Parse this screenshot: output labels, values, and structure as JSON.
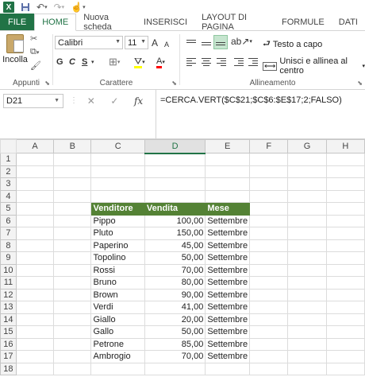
{
  "app": {
    "logo": "X"
  },
  "qat": {
    "icons": [
      "save-icon",
      "undo-icon",
      "redo-icon",
      "touch-icon"
    ]
  },
  "tabs": [
    {
      "label": "FILE"
    },
    {
      "label": "HOME"
    },
    {
      "label": "Nuova scheda"
    },
    {
      "label": "INSERISCI"
    },
    {
      "label": "LAYOUT DI PAGINA"
    },
    {
      "label": "FORMULE"
    },
    {
      "label": "DATI"
    }
  ],
  "ribbon": {
    "clipboard": {
      "paste_label": "Incolla",
      "group_label": "Appunti"
    },
    "font": {
      "name": "Calibri",
      "size": "11",
      "bold": "G",
      "italic": "C",
      "underline": "S",
      "grow": "A",
      "shrink": "A",
      "font_color": "A",
      "group_label": "Carattere"
    },
    "alignment": {
      "wrap_text": "Testo a capo",
      "merge_center": "Unisci e allinea al centro",
      "group_label": "Allineamento"
    }
  },
  "formula_bar": {
    "name_box": "D21",
    "fx": "fx",
    "formula": "=CERCA.VERT($C$21;$C$6:$E$17;2;FALSO)"
  },
  "grid": {
    "columns": [
      "A",
      "B",
      "C",
      "D",
      "E",
      "F",
      "G",
      "H"
    ],
    "selected_column": "D",
    "row_numbers": [
      "1",
      "2",
      "3",
      "4",
      "5",
      "6",
      "7",
      "8",
      "9",
      "10",
      "11",
      "12",
      "13",
      "14",
      "15",
      "16",
      "17",
      "18"
    ],
    "header": {
      "venditore": "Venditore",
      "vendita": "Vendita",
      "mese": "Mese"
    },
    "rows": [
      {
        "venditore": "Pippo",
        "vendita": "100,00",
        "mese": "Settembre"
      },
      {
        "venditore": "Pluto",
        "vendita": "150,00",
        "mese": "Settembre"
      },
      {
        "venditore": "Paperino",
        "vendita": "45,00",
        "mese": "Settembre"
      },
      {
        "venditore": "Topolino",
        "vendita": "50,00",
        "mese": "Settembre"
      },
      {
        "venditore": "Rossi",
        "vendita": "70,00",
        "mese": "Settembre"
      },
      {
        "venditore": "Bruno",
        "vendita": "80,00",
        "mese": "Settembre"
      },
      {
        "venditore": "Brown",
        "vendita": "90,00",
        "mese": "Settembre"
      },
      {
        "venditore": "Verdi",
        "vendita": "41,00",
        "mese": "Settembre"
      },
      {
        "venditore": "Giallo",
        "vendita": "20,00",
        "mese": "Settembre"
      },
      {
        "venditore": "Gallo",
        "vendita": "50,00",
        "mese": "Settembre"
      },
      {
        "venditore": "Petrone",
        "vendita": "85,00",
        "mese": "Settembre"
      },
      {
        "venditore": "Ambrogio",
        "vendita": "70,00",
        "mese": "Settembre"
      }
    ]
  },
  "colors": {
    "excel_green": "#217346",
    "table_header_green": "#548235"
  }
}
